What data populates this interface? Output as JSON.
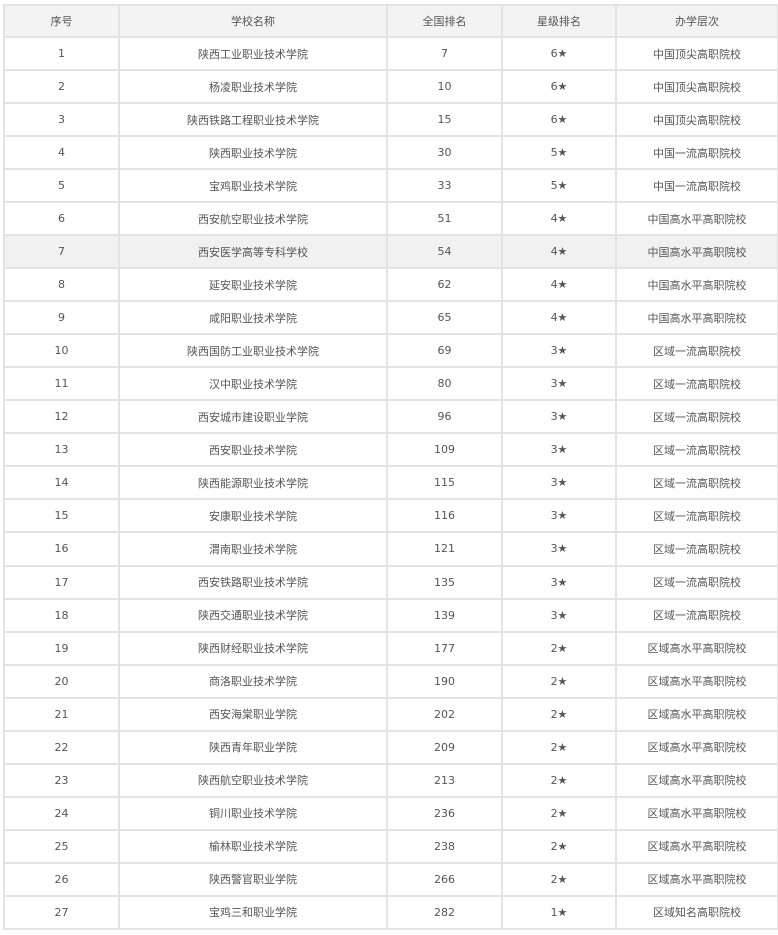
{
  "table": {
    "headers": [
      "序号",
      "学校名称",
      "全国排名",
      "星级排名",
      "办学层次"
    ],
    "highlight_row": "7",
    "rows": [
      [
        "1",
        "陕西工业职业技术学院",
        "7",
        "6★",
        "中国顶尖高职院校"
      ],
      [
        "2",
        "杨凌职业技术学院",
        "10",
        "6★",
        "中国顶尖高职院校"
      ],
      [
        "3",
        "陕西铁路工程职业技术学院",
        "15",
        "6★",
        "中国顶尖高职院校"
      ],
      [
        "4",
        "陕西职业技术学院",
        "30",
        "5★",
        "中国一流高职院校"
      ],
      [
        "5",
        "宝鸡职业技术学院",
        "33",
        "5★",
        "中国一流高职院校"
      ],
      [
        "6",
        "西安航空职业技术学院",
        "51",
        "4★",
        "中国高水平高职院校"
      ],
      [
        "7",
        "西安医学高等专科学校",
        "54",
        "4★",
        "中国高水平高职院校"
      ],
      [
        "8",
        "延安职业技术学院",
        "62",
        "4★",
        "中国高水平高职院校"
      ],
      [
        "9",
        "咸阳职业技术学院",
        "65",
        "4★",
        "中国高水平高职院校"
      ],
      [
        "10",
        "陕西国防工业职业技术学院",
        "69",
        "3★",
        "区域一流高职院校"
      ],
      [
        "11",
        "汉中职业技术学院",
        "80",
        "3★",
        "区域一流高职院校"
      ],
      [
        "12",
        "西安城市建设职业学院",
        "96",
        "3★",
        "区域一流高职院校"
      ],
      [
        "13",
        "西安职业技术学院",
        "109",
        "3★",
        "区域一流高职院校"
      ],
      [
        "14",
        "陕西能源职业技术学院",
        "115",
        "3★",
        "区域一流高职院校"
      ],
      [
        "15",
        "安康职业技术学院",
        "116",
        "3★",
        "区域一流高职院校"
      ],
      [
        "16",
        "渭南职业技术学院",
        "121",
        "3★",
        "区域一流高职院校"
      ],
      [
        "17",
        "西安铁路职业技术学院",
        "135",
        "3★",
        "区域一流高职院校"
      ],
      [
        "18",
        "陕西交通职业技术学院",
        "139",
        "3★",
        "区域一流高职院校"
      ],
      [
        "19",
        "陕西财经职业技术学院",
        "177",
        "2★",
        "区域高水平高职院校"
      ],
      [
        "20",
        "商洛职业技术学院",
        "190",
        "2★",
        "区域高水平高职院校"
      ],
      [
        "21",
        "西安海棠职业学院",
        "202",
        "2★",
        "区域高水平高职院校"
      ],
      [
        "22",
        "陕西青年职业学院",
        "209",
        "2★",
        "区域高水平高职院校"
      ],
      [
        "23",
        "陕西航空职业技术学院",
        "213",
        "2★",
        "区域高水平高职院校"
      ],
      [
        "24",
        "铜川职业技术学院",
        "236",
        "2★",
        "区域高水平高职院校"
      ],
      [
        "25",
        "榆林职业技术学院",
        "238",
        "2★",
        "区域高水平高职院校"
      ],
      [
        "26",
        "陕西警官职业学院",
        "266",
        "2★",
        "区域高水平高职院校"
      ],
      [
        "27",
        "宝鸡三和职业学院",
        "282",
        "1★",
        "区域知名高职院校"
      ]
    ]
  }
}
